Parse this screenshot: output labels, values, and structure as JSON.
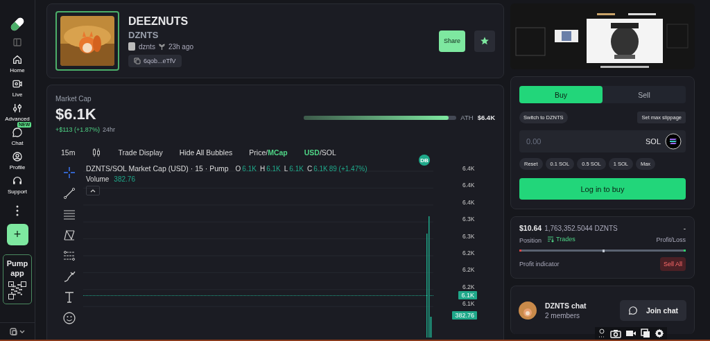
{
  "sidebar": {
    "items": [
      {
        "label": "Home"
      },
      {
        "label": "Live"
      },
      {
        "label": "Advanced"
      },
      {
        "label": "Chat",
        "badge": "NEW"
      },
      {
        "label": "Profile"
      },
      {
        "label": "Support"
      }
    ],
    "create_button": "+",
    "app_promo": {
      "title": "Pump app"
    }
  },
  "token": {
    "name": "DEEZNUTS",
    "ticker": "DZNTS",
    "creator": "dznts",
    "age": "23h ago",
    "address": "6qob...eTfV",
    "share_button": "Share"
  },
  "market": {
    "label": "Market Cap",
    "value": "$6.1K",
    "change": "+$113 (+1.87%)",
    "period": "24hr",
    "ath": {
      "label": "ATH",
      "value": "$6.4K",
      "level": 0.95
    }
  },
  "chart_toolbar": {
    "interval": "15m",
    "items": [
      {
        "label": "Trade Display"
      },
      {
        "label": "Hide All Bubbles"
      }
    ],
    "toggles": [
      {
        "options": [
          {
            "label": "Price",
            "selected": false
          },
          {
            "label": "MCap",
            "selected": true
          }
        ],
        "separator": "/"
      },
      {
        "options": [
          {
            "label": "USD",
            "selected": true
          },
          {
            "label": "SOL",
            "selected": false
          }
        ],
        "separator": "/"
      }
    ]
  },
  "chart": {
    "title": "DZNTS/SOL Market Cap (USD) · 15 · Pump",
    "ohlc": [
      {
        "label": "O",
        "value": "6.1K"
      },
      {
        "label": "H",
        "value": "6.1K"
      },
      {
        "label": "L",
        "value": "6.1K"
      },
      {
        "label": "C",
        "value": "6.1K"
      }
    ],
    "change": "89 (+1.47%)",
    "volume_label": "Volume",
    "volume_value": "382.76",
    "marker": "DB",
    "y_labels": [
      "6.4K",
      "6.4K",
      "6.4K",
      "6.3K",
      "6.3K",
      "6.2K",
      "6.2K",
      "6.2K",
      "6.1K"
    ],
    "price_tag": "6.1K",
    "volume_tag": "382.76"
  },
  "trade": {
    "tabs": [
      {
        "label": "Buy",
        "selected": true
      },
      {
        "label": "Sell",
        "selected": false
      }
    ],
    "switch_button": "Switch to DZNTS",
    "slippage_button": "Set max slippage",
    "amount_placeholder": "0.00",
    "currency": "SOL",
    "presets": [
      "Reset",
      "0.1 SOL",
      "0.5 SOL",
      "1 SOL",
      "Max"
    ],
    "login_button": "Log in to buy"
  },
  "position": {
    "value": "$10.64",
    "amount": "1,763,352.5044 DZNTS",
    "pnl": "-",
    "position_label": "Position",
    "trades_link": "Trades",
    "pnl_label": "Profit/Loss",
    "indicator_label": "Profit indicator",
    "sell_all_button": "Sell All"
  },
  "community": {
    "name": "DZNTS chat",
    "members": "2 members",
    "join_button": "Join chat"
  }
}
